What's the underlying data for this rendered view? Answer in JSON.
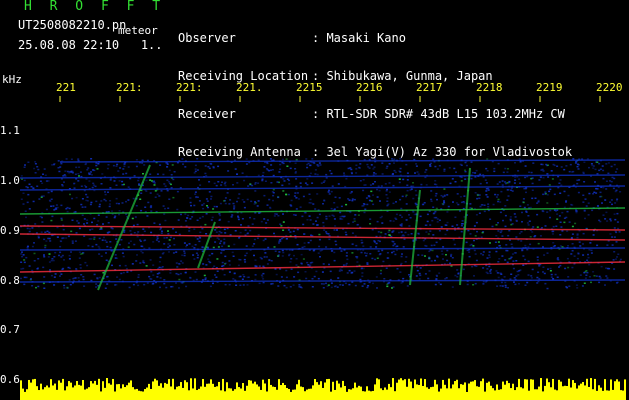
{
  "header": {
    "title": "H R O F F T",
    "filename": "UT2508082210.pn",
    "meteor_label": "meteor",
    "datetime": "25.08.08 22:10   1..",
    "info": [
      {
        "label": "Observer",
        "value": ": Masaki Kano"
      },
      {
        "label": "Receiving Location",
        "value": ": Shibukawa, Gunma, Japan"
      },
      {
        "label": "Receiver",
        "value": ": RTL-SDR SDR# 43dB L15 103.2MHz CW"
      },
      {
        "label": "Receiving Antenna",
        "value": ": 3el Yagi(V) Az 330 for Vladivostok"
      }
    ]
  },
  "spectrogram": {
    "unit": "kHz",
    "y_ticks": [
      "1.1",
      "1.0",
      "0.9",
      "0.8",
      "0.7",
      "0.6"
    ],
    "x_ticks": [
      "221",
      "221:",
      "221:",
      "221.",
      "2215",
      "2216",
      "2217",
      "2218",
      "2219",
      "2220"
    ],
    "colors": {
      "background": "#000000",
      "low": "#1030c0",
      "mid": "#20c040",
      "high": "#ff3040",
      "activity": "#ffff00",
      "tick": "#ffff33"
    }
  }
}
